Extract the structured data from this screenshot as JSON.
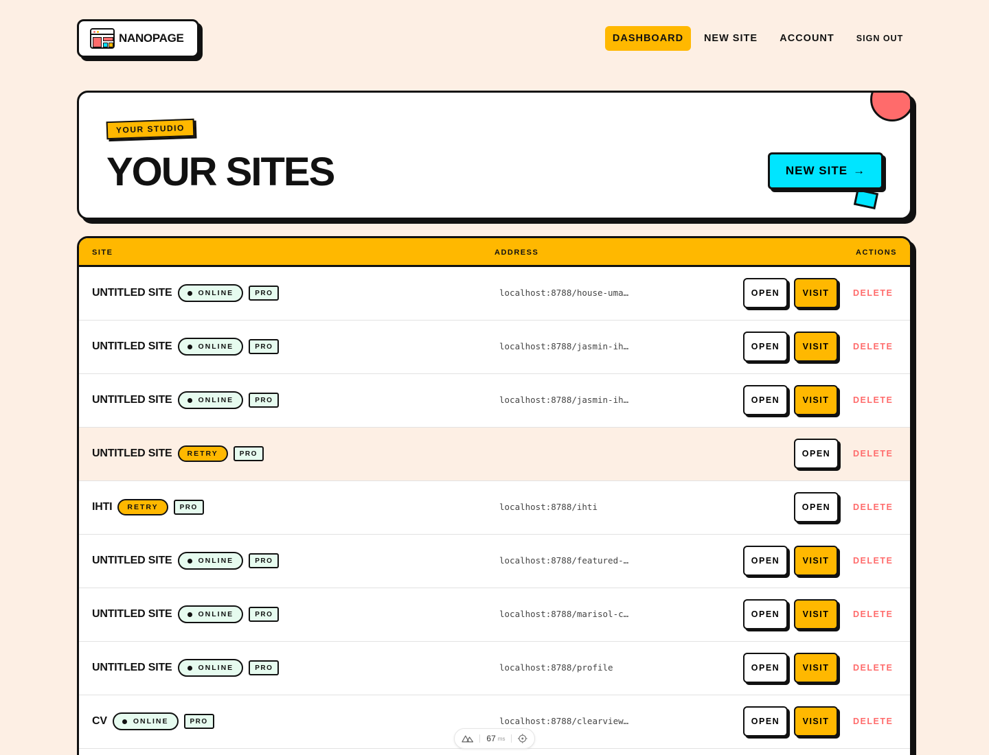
{
  "app": {
    "logo_text": "NANOPAGE"
  },
  "nav": {
    "items": [
      {
        "label": "DASHBOARD",
        "active": true
      },
      {
        "label": "NEW SITE",
        "active": false
      },
      {
        "label": "ACCOUNT",
        "active": false
      },
      {
        "label": "SIGN OUT",
        "active": false
      }
    ]
  },
  "hero": {
    "tag": "YOUR STUDIO",
    "title": "YOUR SITES",
    "new_site_label": "NEW SITE",
    "new_site_arrow": "→"
  },
  "table": {
    "headers": {
      "site": "SITE",
      "address": "ADDRESS",
      "actions": "ACTIONS"
    },
    "open_label": "OPEN",
    "visit_label": "VISIT",
    "delete_label": "DELETE",
    "rows": [
      {
        "name": "UNTITLED SITE",
        "status": "ONLINE",
        "plan": "PRO",
        "address": "localhost:8788/house-uma…",
        "visit": true,
        "highlight": false
      },
      {
        "name": "UNTITLED SITE",
        "status": "ONLINE",
        "plan": "PRO",
        "address": "localhost:8788/jasmin-ih…",
        "visit": true,
        "highlight": false
      },
      {
        "name": "UNTITLED SITE",
        "status": "ONLINE",
        "plan": "PRO",
        "address": "localhost:8788/jasmin-ih…",
        "visit": true,
        "highlight": false
      },
      {
        "name": "UNTITLED SITE",
        "status": "RETRY",
        "plan": "PRO",
        "address": "",
        "visit": false,
        "highlight": true
      },
      {
        "name": "IHTI",
        "status": "RETRY",
        "plan": "PRO",
        "address": "localhost:8788/ihti",
        "visit": false,
        "highlight": false
      },
      {
        "name": "UNTITLED SITE",
        "status": "ONLINE",
        "plan": "PRO",
        "address": "localhost:8788/featured-…",
        "visit": true,
        "highlight": false
      },
      {
        "name": "UNTITLED SITE",
        "status": "ONLINE",
        "plan": "PRO",
        "address": "localhost:8788/marisol-c…",
        "visit": true,
        "highlight": false
      },
      {
        "name": "UNTITLED SITE",
        "status": "ONLINE",
        "plan": "PRO",
        "address": "localhost:8788/profile",
        "visit": true,
        "highlight": false
      },
      {
        "name": "CV",
        "status": "ONLINE",
        "plan": "PRO",
        "address": "localhost:8788/clearview…",
        "visit": true,
        "highlight": false
      }
    ]
  },
  "devtools": {
    "time": "67",
    "unit": "ms"
  },
  "colors": {
    "background": "#fdefe4",
    "accent_yellow": "#ffb800",
    "accent_cyan": "#00e5ff",
    "accent_coral": "#ff6b6b",
    "online_badge": "#e6fbef",
    "ink": "#111111"
  },
  "icons": {
    "logo": "nanopage-logo-icon",
    "arrow": "arrow-right-icon",
    "devtools": "nuxt-logo-icon",
    "inspect": "crosshair-icon"
  }
}
